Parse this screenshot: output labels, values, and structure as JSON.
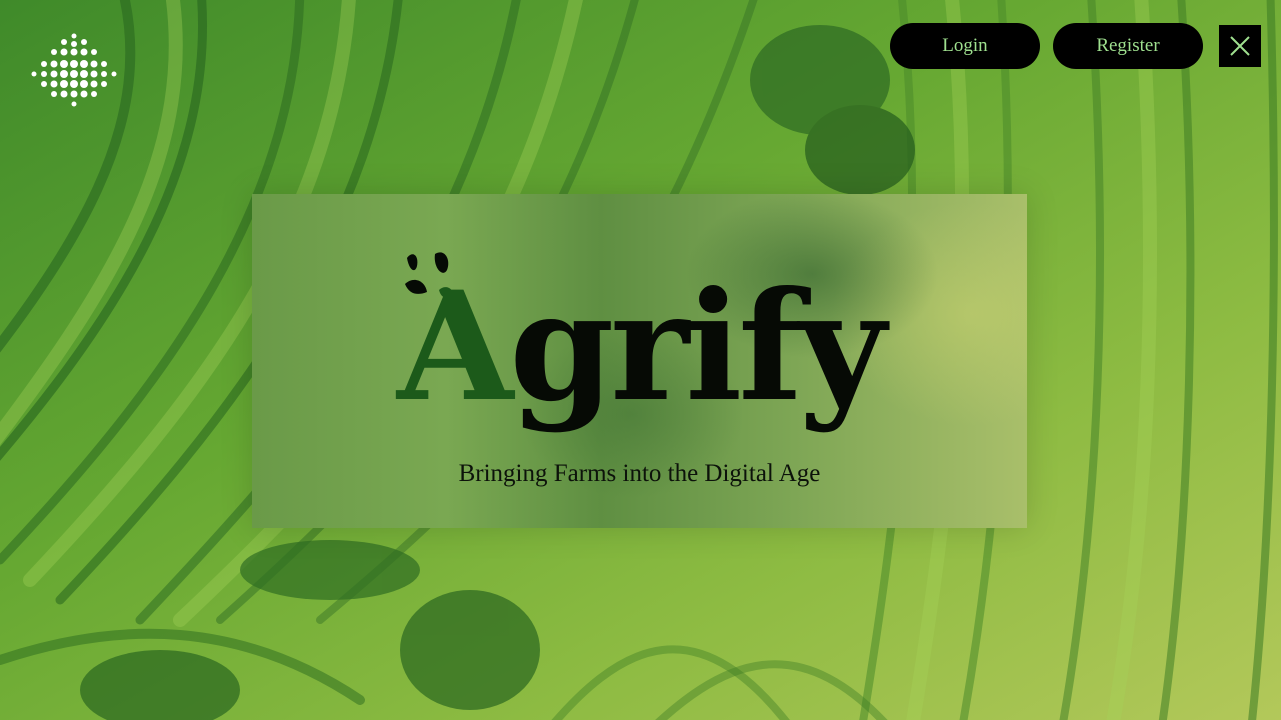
{
  "header": {
    "login_label": "Login",
    "register_label": "Register"
  },
  "hero": {
    "brand_first_letter": "A",
    "brand_rest": "grify",
    "tagline": "Bringing Farms into the Digital Age"
  },
  "icons": {
    "logo": "dotted-sun-logo-icon",
    "close": "close-icon",
    "brand_accent": "leaf-accent-icon"
  },
  "colors": {
    "button_bg": "#000000",
    "button_text": "#9fe08f",
    "brand_green": "#1c5a1a",
    "brand_dark": "#060a05"
  }
}
